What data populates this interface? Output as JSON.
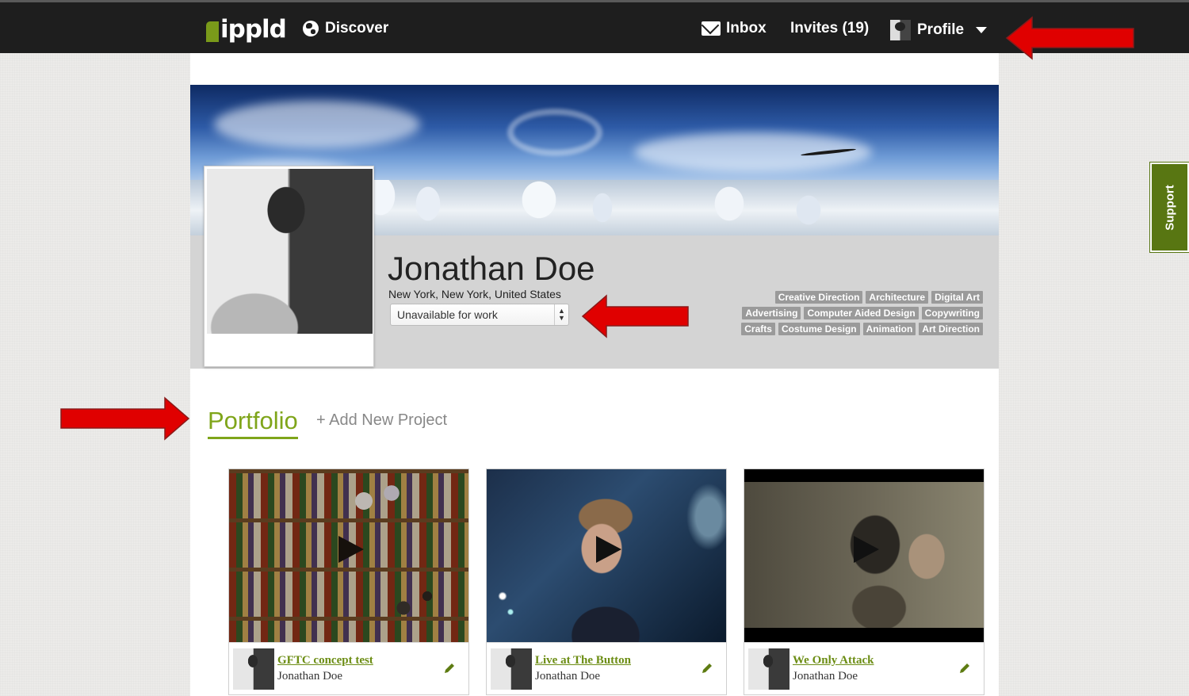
{
  "nav": {
    "logo_text": "ippld",
    "discover": "Discover",
    "inbox": "Inbox",
    "invites": "Invites (19)",
    "profile": "Profile"
  },
  "profile": {
    "name": "Jonathan Doe",
    "location": "New York, New York, United States",
    "availability": "Unavailable for work",
    "skills": [
      "Creative Direction",
      "Architecture",
      "Digital Art",
      "Advertising",
      "Computer Aided Design",
      "Copywriting",
      "Crafts",
      "Costume Design",
      "Animation",
      "Art Direction"
    ]
  },
  "portfolio": {
    "title": "Portfolio",
    "add_project": "+ Add New Project",
    "projects": [
      {
        "title": "GFTC concept test",
        "author": "Jonathan Doe"
      },
      {
        "title": "Live at The Button",
        "author": "Jonathan Doe"
      },
      {
        "title": "We Only Attack",
        "author": "Jonathan Doe"
      }
    ]
  },
  "support": {
    "label": "Support"
  },
  "colors": {
    "accent": "#7fa51a",
    "topbar": "#1e1e1e",
    "support_bg": "#587612",
    "annotation_arrow": "#e00000"
  }
}
